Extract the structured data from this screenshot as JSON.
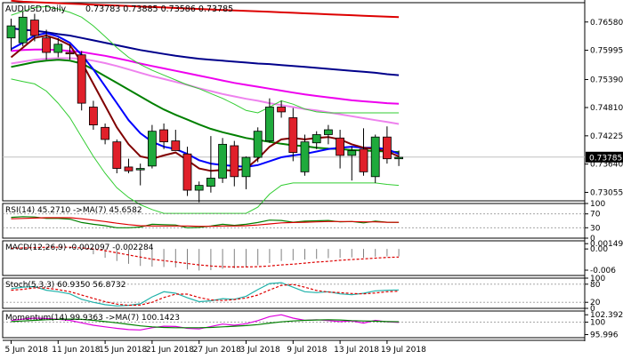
{
  "header": {
    "symbol": "AUDUSD,Daily",
    "ohlc": "0.73783 0.73885 0.73586 0.73785"
  },
  "chart_data": {
    "type": "candlestick",
    "price_axis": {
      "ticks": [
        0.7658,
        0.75995,
        0.7539,
        0.7481,
        0.74225,
        0.7364,
        0.73055
      ],
      "tick_labels": [
        "0.76580",
        "0.75995",
        "0.75390",
        "0.74810",
        "0.74225",
        "0.73640",
        "0.73055"
      ],
      "current_price_label": "0.73785",
      "current_price": 0.73785,
      "ylim": [
        0.7288,
        0.7698
      ]
    },
    "date_labels": [
      "5 Jun 2018",
      "11 Jun 2018",
      "15 Jun 2018",
      "21 Jun 2018",
      "27 Jun 2018",
      "3 Jul 2018",
      "9 Jul 2018",
      "13 Jul 2018",
      "19 Jul 2018"
    ],
    "date_label_bars": [
      0,
      4,
      8,
      12,
      16,
      20,
      24,
      28,
      32
    ],
    "candles": [
      {
        "o": 0.7625,
        "h": 0.7665,
        "l": 0.7598,
        "c": 0.765
      },
      {
        "o": 0.7615,
        "h": 0.768,
        "l": 0.7608,
        "c": 0.7668
      },
      {
        "o": 0.7662,
        "h": 0.7675,
        "l": 0.7618,
        "c": 0.763
      },
      {
        "o": 0.7625,
        "h": 0.7642,
        "l": 0.758,
        "c": 0.7595
      },
      {
        "o": 0.7595,
        "h": 0.7625,
        "l": 0.7585,
        "c": 0.7612
      },
      {
        "o": 0.7595,
        "h": 0.7612,
        "l": 0.758,
        "c": 0.7592
      },
      {
        "o": 0.759,
        "h": 0.7598,
        "l": 0.7475,
        "c": 0.749
      },
      {
        "o": 0.7482,
        "h": 0.7495,
        "l": 0.7435,
        "c": 0.7445
      },
      {
        "o": 0.744,
        "h": 0.7448,
        "l": 0.7405,
        "c": 0.7415
      },
      {
        "o": 0.741,
        "h": 0.7415,
        "l": 0.7345,
        "c": 0.7355
      },
      {
        "o": 0.7358,
        "h": 0.7375,
        "l": 0.7345,
        "c": 0.735
      },
      {
        "o": 0.7352,
        "h": 0.7365,
        "l": 0.732,
        "c": 0.7355
      },
      {
        "o": 0.736,
        "h": 0.7445,
        "l": 0.7355,
        "c": 0.7432
      },
      {
        "o": 0.7435,
        "h": 0.7448,
        "l": 0.7395,
        "c": 0.741
      },
      {
        "o": 0.7412,
        "h": 0.7435,
        "l": 0.7395,
        "c": 0.7392
      },
      {
        "o": 0.7385,
        "h": 0.74,
        "l": 0.7298,
        "c": 0.731
      },
      {
        "o": 0.731,
        "h": 0.7328,
        "l": 0.7285,
        "c": 0.732
      },
      {
        "o": 0.7318,
        "h": 0.7422,
        "l": 0.7305,
        "c": 0.7335
      },
      {
        "o": 0.7335,
        "h": 0.7418,
        "l": 0.7325,
        "c": 0.7405
      },
      {
        "o": 0.7402,
        "h": 0.7412,
        "l": 0.7318,
        "c": 0.7338
      },
      {
        "o": 0.7338,
        "h": 0.738,
        "l": 0.7312,
        "c": 0.7378
      },
      {
        "o": 0.7378,
        "h": 0.744,
        "l": 0.7368,
        "c": 0.7432
      },
      {
        "o": 0.7412,
        "h": 0.75,
        "l": 0.7408,
        "c": 0.7482
      },
      {
        "o": 0.7482,
        "h": 0.7495,
        "l": 0.746,
        "c": 0.7472
      },
      {
        "o": 0.746,
        "h": 0.748,
        "l": 0.737,
        "c": 0.7388
      },
      {
        "o": 0.7348,
        "h": 0.7425,
        "l": 0.734,
        "c": 0.741
      },
      {
        "o": 0.7408,
        "h": 0.7432,
        "l": 0.7395,
        "c": 0.7425
      },
      {
        "o": 0.7425,
        "h": 0.7445,
        "l": 0.7405,
        "c": 0.7435
      },
      {
        "o": 0.7418,
        "h": 0.7435,
        "l": 0.7355,
        "c": 0.7382
      },
      {
        "o": 0.7382,
        "h": 0.74,
        "l": 0.733,
        "c": 0.7392
      },
      {
        "o": 0.7395,
        "h": 0.7438,
        "l": 0.734,
        "c": 0.7348
      },
      {
        "o": 0.7338,
        "h": 0.7425,
        "l": 0.7325,
        "c": 0.742
      },
      {
        "o": 0.742,
        "h": 0.7442,
        "l": 0.7365,
        "c": 0.7375
      },
      {
        "o": 0.7375,
        "h": 0.7392,
        "l": 0.736,
        "c": 0.7378
      }
    ],
    "overlays": [
      {
        "color": "#dd0000",
        "values": [
          0.7702,
          0.77,
          0.7699,
          0.7698,
          0.7697,
          0.7696,
          0.7695,
          0.7694,
          0.7693,
          0.7692,
          0.7691,
          0.769,
          0.7689,
          0.7688,
          0.7687,
          0.7686,
          0.7685,
          0.7684,
          0.7683,
          0.7682,
          0.7681,
          0.768,
          0.7679,
          0.7678,
          0.7677,
          0.7676,
          0.7675,
          0.7674,
          0.7673,
          0.7672,
          0.7671,
          0.767,
          0.7669,
          0.7668
        ]
      },
      {
        "color": "#00008b",
        "values": [
          0.7645,
          0.7642,
          0.764,
          0.7637,
          0.7633,
          0.763,
          0.7625,
          0.762,
          0.7615,
          0.761,
          0.7605,
          0.76,
          0.7596,
          0.7592,
          0.7588,
          0.7585,
          0.7582,
          0.758,
          0.7578,
          0.7576,
          0.7574,
          0.7572,
          0.7571,
          0.7569,
          0.7567,
          0.7565,
          0.7563,
          0.7561,
          0.7559,
          0.7557,
          0.7555,
          0.7553,
          0.755,
          0.7548
        ]
      },
      {
        "color": "#ee00ee",
        "values": [
          0.7598,
          0.76,
          0.7601,
          0.7601,
          0.76,
          0.7598,
          0.7596,
          0.7592,
          0.7588,
          0.7583,
          0.7578,
          0.7572,
          0.7567,
          0.7562,
          0.7557,
          0.7552,
          0.7547,
          0.7542,
          0.7537,
          0.7532,
          0.7528,
          0.7524,
          0.752,
          0.7516,
          0.7512,
          0.7508,
          0.7505,
          0.7502,
          0.7499,
          0.7496,
          0.7494,
          0.7492,
          0.749,
          0.7489
        ]
      },
      {
        "color": "#ee82ee",
        "values": [
          0.7572,
          0.7576,
          0.758,
          0.7582,
          0.7583,
          0.7583,
          0.7582,
          0.7578,
          0.7573,
          0.7567,
          0.756,
          0.7553,
          0.7546,
          0.754,
          0.7534,
          0.7528,
          0.7521,
          0.7515,
          0.7509,
          0.7504,
          0.7499,
          0.7495,
          0.749,
          0.7486,
          0.7482,
          0.7478,
          0.7475,
          0.7471,
          0.7467,
          0.7463,
          0.7459,
          0.7455,
          0.7451,
          0.7447
        ]
      },
      {
        "color": "#008000",
        "values": [
          0.7565,
          0.757,
          0.7575,
          0.7578,
          0.758,
          0.7578,
          0.7572,
          0.756,
          0.7546,
          0.7532,
          0.7518,
          0.7504,
          0.749,
          0.7477,
          0.7466,
          0.7456,
          0.7446,
          0.7437,
          0.743,
          0.7424,
          0.7418,
          0.7414,
          0.741,
          0.7406,
          0.7403,
          0.7401,
          0.7398,
          0.7396,
          0.7395,
          0.7393,
          0.7392,
          0.7391,
          0.739,
          0.7389
        ]
      },
      {
        "color": "#0000ff",
        "values": [
          0.7602,
          0.7615,
          0.763,
          0.7635,
          0.7628,
          0.7615,
          0.759,
          0.756,
          0.7525,
          0.749,
          0.7455,
          0.7428,
          0.741,
          0.74,
          0.7395,
          0.7385,
          0.7372,
          0.7365,
          0.7362,
          0.736,
          0.7358,
          0.7362,
          0.737,
          0.7378,
          0.7382,
          0.7385,
          0.739,
          0.7395,
          0.7398,
          0.74,
          0.7398,
          0.7398,
          0.7395,
          0.7385
        ]
      },
      {
        "color": "#800000",
        "values": [
          0.7585,
          0.7605,
          0.7625,
          0.763,
          0.7622,
          0.761,
          0.7575,
          0.753,
          0.7485,
          0.744,
          0.7405,
          0.738,
          0.7375,
          0.7382,
          0.7388,
          0.7372,
          0.7355,
          0.735,
          0.7352,
          0.735,
          0.7355,
          0.7375,
          0.74,
          0.7415,
          0.7418,
          0.7415,
          0.7418,
          0.742,
          0.7415,
          0.7405,
          0.7398,
          0.7395,
          0.739,
          0.738
        ]
      },
      {
        "color": "#32cd32",
        "values": [
          0.7672,
          0.768,
          0.7688,
          0.769,
          0.7685,
          0.7678,
          0.7668,
          0.765,
          0.7628,
          0.7605,
          0.7585,
          0.757,
          0.7558,
          0.7548,
          0.7538,
          0.7528,
          0.752,
          0.751,
          0.75,
          0.7488,
          0.7475,
          0.747,
          0.7482,
          0.7495,
          0.7488,
          0.7478,
          0.7472,
          0.747,
          0.747,
          0.747,
          0.747,
          0.747,
          0.747,
          0.747
        ]
      },
      {
        "color": "#32cd32",
        "values": [
          0.754,
          0.7535,
          0.753,
          0.7515,
          0.749,
          0.746,
          0.742,
          0.738,
          0.7345,
          0.7315,
          0.7295,
          0.728,
          0.727,
          0.7262,
          0.7262,
          0.7262,
          0.7262,
          0.7262,
          0.7262,
          0.7262,
          0.7262,
          0.7275,
          0.7302,
          0.732,
          0.7325,
          0.7325,
          0.7325,
          0.7325,
          0.7325,
          0.7325,
          0.7325,
          0.7325,
          0.7322,
          0.732
        ]
      }
    ],
    "panels": [
      {
        "id": "rsi",
        "label": "RSI(14) 45.2710 ->MA(7) 45.6582",
        "ylim": [
          0,
          100
        ],
        "tick_labels": [
          "100",
          "70",
          "30",
          "0"
        ],
        "ticks": [
          100,
          70,
          30,
          0
        ],
        "dashed_levels": [
          70,
          30
        ],
        "lines": [
          {
            "color": "#008000",
            "values": [
              60,
              62,
              61,
              57,
              57,
              55,
              45,
              40,
              36,
              30,
              30,
              32,
              40,
              39,
              38,
              30,
              31,
              35,
              40,
              37,
              40,
              45,
              52,
              51,
              46,
              49,
              50,
              51,
              47,
              48,
              44,
              49,
              46,
              45.27
            ]
          },
          {
            "color": "#dd0000",
            "values": [
              56,
              57,
              58,
              59,
              59,
              59,
              56,
              52,
              48,
              43,
              39,
              36,
              35,
              35,
              35,
              35,
              34,
              34,
              35,
              35,
              36,
              38,
              41,
              44,
              45,
              46,
              47,
              48,
              48,
              48,
              47,
              47,
              46,
              45.66
            ]
          }
        ]
      },
      {
        "id": "macd",
        "label": "MACD(12,26,9) -0.002097 -0.002284",
        "ylim": [
          -0.0075,
          0.0023
        ],
        "tick_labels": [
          "0.001494",
          "0.00",
          "-0.006"
        ],
        "ticks": [
          0.001494,
          0.0,
          -0.006
        ],
        "histogram": {
          "color": "#808080",
          "values": [
            0.0004,
            0.0005,
            0.0006,
            0.0006,
            0.0005,
            0.0003,
            -0.0005,
            -0.0015,
            -0.0025,
            -0.0034,
            -0.0042,
            -0.0048,
            -0.005,
            -0.0051,
            -0.0052,
            -0.0058,
            -0.0061,
            -0.006,
            -0.0056,
            -0.0055,
            -0.0052,
            -0.0046,
            -0.004,
            -0.0034,
            -0.0032,
            -0.003,
            -0.0028,
            -0.0026,
            -0.0025,
            -0.0024,
            -0.0025,
            -0.0022,
            -0.0021,
            -0.0021
          ]
        },
        "lines": [
          {
            "color": "#dd0000",
            "dashed": true,
            "values": [
              0.0002,
              0.0003,
              0.0004,
              0.0005,
              0.0005,
              0.0005,
              0.0003,
              0.0,
              -0.0005,
              -0.0011,
              -0.0017,
              -0.0023,
              -0.0029,
              -0.0033,
              -0.0037,
              -0.0041,
              -0.0045,
              -0.0048,
              -0.005,
              -0.0051,
              -0.0051,
              -0.005,
              -0.0048,
              -0.0045,
              -0.0043,
              -0.004,
              -0.0037,
              -0.0035,
              -0.0032,
              -0.003,
              -0.0028,
              -0.0026,
              -0.0024,
              -0.0023
            ]
          }
        ]
      },
      {
        "id": "stoch",
        "label": "Stoch(5,3,3) 60.9350 56.8732",
        "ylim": [
          0,
          100
        ],
        "tick_labels": [
          "100",
          "80",
          "20",
          "0"
        ],
        "ticks": [
          100,
          80,
          20,
          0
        ],
        "dashed_levels": [
          80,
          20
        ],
        "lines": [
          {
            "color": "#20b2aa",
            "values": [
              65,
              70,
              72,
              60,
              55,
              48,
              30,
              20,
              12,
              8,
              10,
              15,
              38,
              55,
              50,
              35,
              22,
              25,
              32,
              30,
              40,
              62,
              82,
              85,
              70,
              55,
              52,
              55,
              48,
              45,
              50,
              58,
              60,
              60.94
            ]
          },
          {
            "color": "#dd0000",
            "dashed": true,
            "values": [
              60,
              63,
              68,
              67,
              62,
              55,
              44,
              33,
              22,
              14,
              10,
              11,
              20,
              36,
              47,
              47,
              36,
              28,
              26,
              29,
              34,
              44,
              61,
              76,
              79,
              70,
              59,
              54,
              52,
              49,
              48,
              51,
              55,
              56.87
            ]
          }
        ]
      },
      {
        "id": "momentum",
        "label": "Momentum(14) 99.9363 ->MA(7) 100.1423",
        "ylim": [
          95.0,
          103.6
        ],
        "tick_labels": [
          "102.3921",
          "100",
          "95.996"
        ],
        "ticks": [
          102.3921,
          100,
          95.996
        ],
        "dashed_levels": [
          100
        ],
        "lines": [
          {
            "color": "#dd00dd",
            "values": [
              100.6,
              101.0,
              101.3,
              101.2,
              100.9,
              100.6,
              99.8,
              99.0,
              98.5,
              98.0,
              97.6,
              97.5,
              98.2,
              98.7,
              98.6,
              98.0,
              97.8,
              98.6,
              99.4,
              99.0,
              99.5,
              100.5,
              101.8,
              102.4,
              101.3,
              100.6,
              100.8,
              100.5,
              100.2,
              100.4,
              99.7,
              100.6,
              100.1,
              99.94
            ]
          },
          {
            "color": "#008000",
            "values": [
              100.2,
              100.4,
              100.6,
              100.8,
              100.9,
              101.0,
              100.9,
              100.6,
              100.2,
              99.8,
              99.3,
              98.8,
              98.5,
              98.3,
              98.2,
              98.2,
              98.2,
              98.3,
              98.5,
              98.7,
              98.9,
              99.2,
              99.7,
              100.1,
              100.4,
              100.6,
              100.7,
              100.8,
              100.7,
              100.5,
              100.4,
              100.3,
              100.2,
              100.14
            ]
          }
        ]
      }
    ]
  }
}
